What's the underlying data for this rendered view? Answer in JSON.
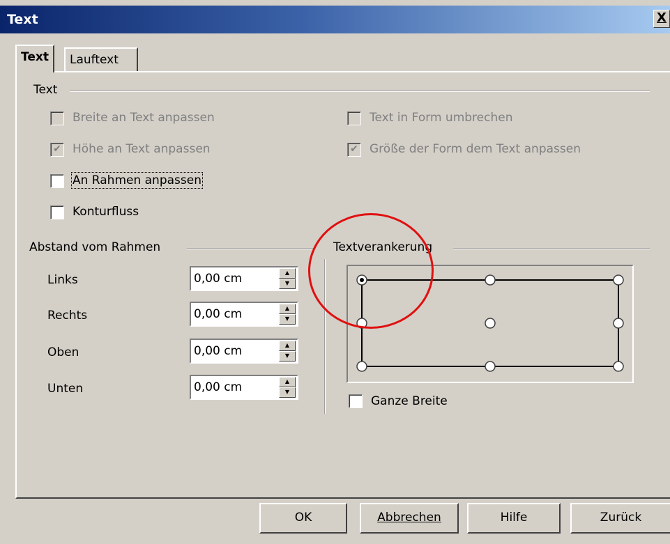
{
  "window": {
    "title": "Text",
    "close_glyph": "X"
  },
  "tabs": [
    {
      "label": "Text",
      "active": true
    },
    {
      "label": "Lauftext",
      "active": false
    }
  ],
  "text_group": {
    "heading": "Text",
    "options": [
      {
        "label": "Breite an Text anpassen",
        "checked": false,
        "enabled": false
      },
      {
        "label": "Text in Form umbrechen",
        "checked": false,
        "enabled": false
      },
      {
        "label": "Höhe an Text anpassen",
        "checked": true,
        "enabled": false
      },
      {
        "label": "Größe der Form dem Text anpassen",
        "checked": true,
        "enabled": false
      },
      {
        "label": "An Rahmen anpassen",
        "checked": false,
        "enabled": true,
        "focused": true
      },
      {
        "label": "Konturfluss",
        "checked": false,
        "enabled": true
      }
    ]
  },
  "spacing_group": {
    "heading": "Abstand vom Rahmen",
    "fields": [
      {
        "label": "Links",
        "value": "0,00 cm"
      },
      {
        "label": "Rechts",
        "value": "0,00 cm"
      },
      {
        "label": "Oben",
        "value": "0,00 cm"
      },
      {
        "label": "Unten",
        "value": "0,00 cm"
      }
    ]
  },
  "anchor_group": {
    "heading": "Textverankerung",
    "selected": "top-left",
    "full_width": {
      "label": "Ganze Breite",
      "checked": false
    }
  },
  "buttons": {
    "ok": "OK",
    "cancel": "Abbrechen",
    "help": "Hilfe",
    "back": "Zurück"
  },
  "annotation": {
    "color": "#e01010"
  }
}
